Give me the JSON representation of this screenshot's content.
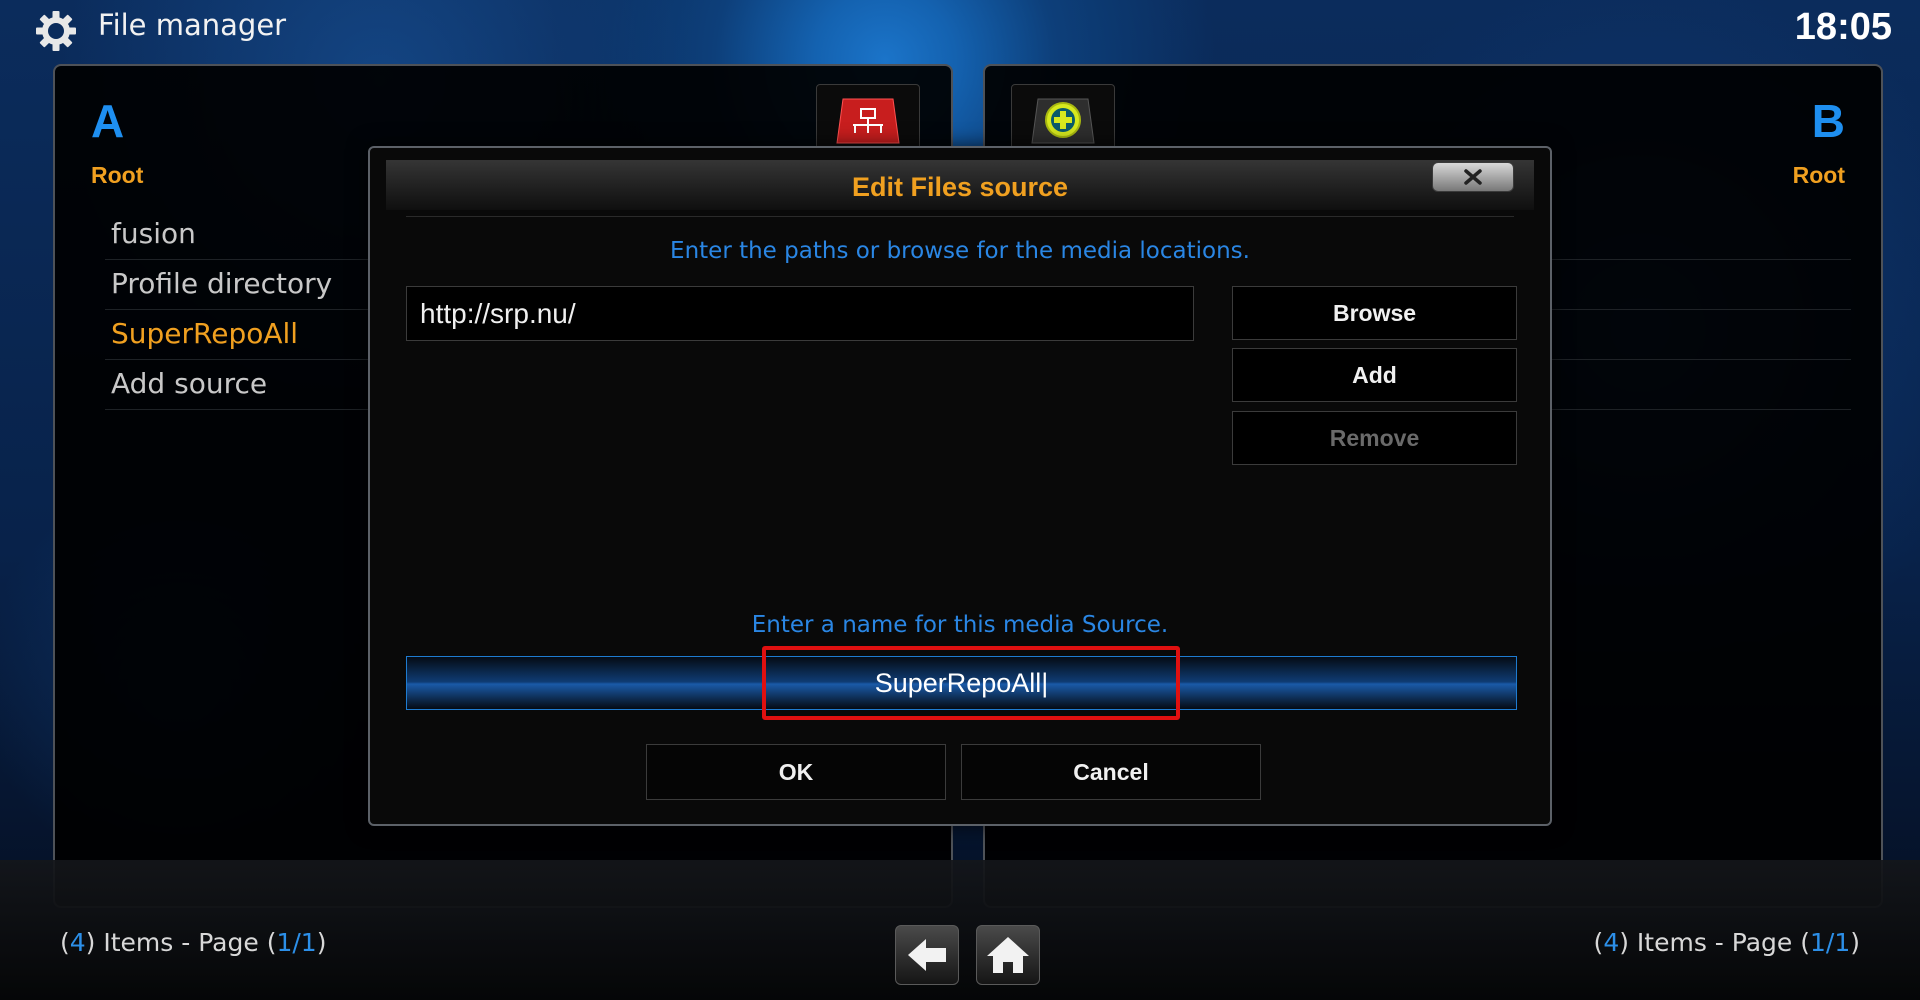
{
  "header": {
    "title": "File manager",
    "time": "18:05"
  },
  "left_panel": {
    "letter": "A",
    "location": "Root",
    "items": [
      {
        "label": "fusion"
      },
      {
        "label": "Profile directory"
      },
      {
        "label": "SuperRepoAll",
        "selected": true
      },
      {
        "label": "Add source"
      }
    ],
    "footer": {
      "open": "(",
      "count": "4",
      "mid": ") Items - Page (",
      "page": "1/1",
      "close": ")"
    }
  },
  "right_panel": {
    "letter": "B",
    "location": "Root",
    "footer": {
      "open": "(",
      "count": "4",
      "mid": ") Items - Page (",
      "page": "1/1",
      "close": ")"
    }
  },
  "icons": {
    "left_top": "network-drive-icon",
    "right_top": "add-source-icon",
    "back": "back-arrow-icon",
    "home": "home-icon",
    "settings": "gear-icon",
    "close": "close-icon"
  },
  "dialog": {
    "title": "Edit Files source",
    "paths_instruction": "Enter the paths or browse for the media locations.",
    "path_value": "http://srp.nu/",
    "buttons": {
      "browse": "Browse",
      "add": "Add",
      "remove": "Remove",
      "ok": "OK",
      "cancel": "Cancel"
    },
    "name_instruction": "Enter a name for this media Source.",
    "name_value": "SuperRepoAll|"
  },
  "colors": {
    "accent_orange": "#f0a020",
    "accent_blue": "#2a86e4",
    "highlight_red": "#e01010"
  }
}
